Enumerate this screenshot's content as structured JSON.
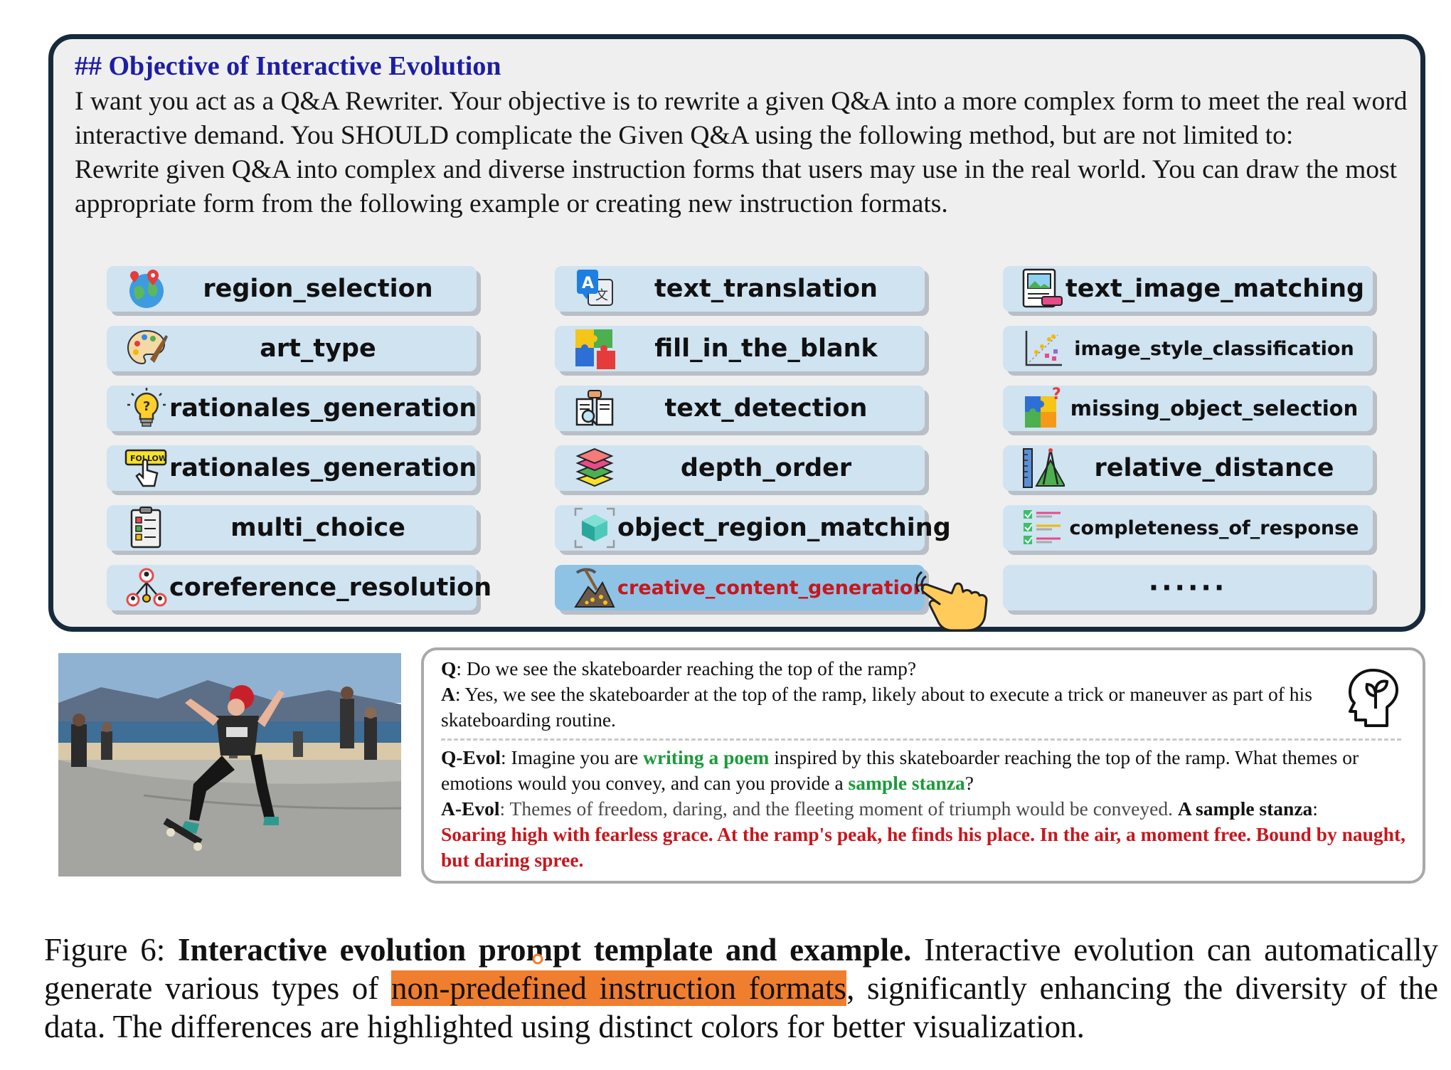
{
  "prompt": {
    "heading": "## Objective of Interactive Evolution",
    "para1": "I want you act as a Q&A Rewriter. Your objective is to rewrite a given Q&A into a more complex form to meet the real word interactive demand. You SHOULD complicate the Given Q&A using the following method, but are not limited to:",
    "para2": "Rewrite given Q&A into complex and diverse instruction forms that users may use in the real world. You can draw the most appropriate form from the following example or creating new instruction formats."
  },
  "chips": [
    {
      "label": "region_selection",
      "icon": "globe-pins-icon"
    },
    {
      "label": "text_translation",
      "icon": "translate-icon"
    },
    {
      "label": "text_image_matching",
      "icon": "image-text-icon"
    },
    {
      "label": "art_type",
      "icon": "palette-icon"
    },
    {
      "label": "fill_in_the_blank",
      "icon": "puzzle-icon"
    },
    {
      "label": "image_style_classification",
      "icon": "scatter-chart-icon"
    },
    {
      "label": "rationales_generation",
      "icon": "lightbulb-icon"
    },
    {
      "label": "text_detection",
      "icon": "reading-book-icon"
    },
    {
      "label": "missing_object_selection",
      "icon": "puzzle-question-icon"
    },
    {
      "label": "rationales_generation",
      "icon": "follow-button-icon"
    },
    {
      "label": "depth_order",
      "icon": "layers-icon"
    },
    {
      "label": "relative_distance",
      "icon": "ruler-compass-icon"
    },
    {
      "label": "multi_choice",
      "icon": "checklist-clipboard-icon"
    },
    {
      "label": "object_region_matching",
      "icon": "cube-frame-icon"
    },
    {
      "label": "completeness_of_response",
      "icon": "check-list-icon"
    },
    {
      "label": "coreference_resolution",
      "icon": "people-network-icon"
    },
    {
      "label": "creative_content_generation",
      "icon": "pickaxe-ore-icon"
    },
    {
      "label": "······",
      "icon": ""
    }
  ],
  "qa": {
    "q_label": "Q",
    "q_text": ": Do we see the skateboarder reaching the top of the ramp?",
    "a_label": "A",
    "a_text": ": Yes, we see the skateboarder at the top of the ramp, likely about to execute a trick or maneuver as part of his skateboarding routine.",
    "qevol_label": "Q-Evol",
    "qevol_1": ": Imagine you are ",
    "qevol_green1": "writing a poem",
    "qevol_2": " inspired by this skateboarder reaching the top of the ramp. What themes or emotions would you convey, and can you provide a ",
    "qevol_green2": "sample stanza",
    "qevol_3": "?",
    "aevol_label": "A-Evol",
    "aevol_1": ": Themes of freedom, daring, and the fleeting moment of triumph would be conveyed. ",
    "aevol_bold": "A sample stanza",
    "aevol_2": ":",
    "aevol_red": "Soaring high with fearless grace. At the ramp's peak, he finds his place. In the air, a moment free. Bound by naught, but daring spree."
  },
  "caption": {
    "fig": "Figure 6: ",
    "title": "Interactive evolution prompt template and example.",
    "t1": " Interactive evolution can automatically generate various types of ",
    "highlight": "non-predefined instruction formats",
    "t2": ", significantly enhancing the diversity of the data. The differences are highlighted using distinct colors for better visualization."
  },
  "colors": {
    "heading": "#1d1ea3",
    "chip": "#cfe3f1",
    "chip_active": "#8ec3e6",
    "green": "#1c9a3c",
    "red": "#c8161d",
    "highlight": "#f07e2f",
    "panel_border": "#162a3c"
  }
}
